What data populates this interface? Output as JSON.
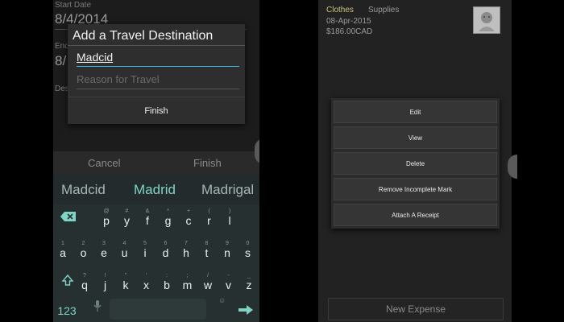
{
  "left": {
    "background": {
      "start_label": "Start Date",
      "start_value": "8/4/2014",
      "end_label_partial": "End",
      "end_value_partial": "8/",
      "desc_label_partial": "Des"
    },
    "dialog": {
      "title": "Add a Travel Destination",
      "destination_value": "Madcid",
      "reason_placeholder": "Reason for Travel",
      "finish_label": "Finish"
    },
    "bottom_buttons": {
      "cancel": "Cancel",
      "finish": "Finish"
    },
    "suggestions": [
      "Madcid",
      "Madrid",
      "Madrigal"
    ],
    "keyboard": {
      "row1": [
        {
          "ch": "p",
          "hint": "@"
        },
        {
          "ch": "y",
          "hint": "#"
        },
        {
          "ch": "f",
          "hint": "&"
        },
        {
          "ch": "g",
          "hint": "*"
        },
        {
          "ch": "c",
          "hint": "+"
        },
        {
          "ch": "r",
          "hint": "("
        },
        {
          "ch": "l",
          "hint": ")"
        }
      ],
      "row2": [
        {
          "ch": "a",
          "hint": "1"
        },
        {
          "ch": "o",
          "hint": "2"
        },
        {
          "ch": "e",
          "hint": "3"
        },
        {
          "ch": "u",
          "hint": "4"
        },
        {
          "ch": "i",
          "hint": "5"
        },
        {
          "ch": "d",
          "hint": "6"
        },
        {
          "ch": "h",
          "hint": "7"
        },
        {
          "ch": "t",
          "hint": "8"
        },
        {
          "ch": "n",
          "hint": "9"
        },
        {
          "ch": "s",
          "hint": "0"
        }
      ],
      "row3": [
        {
          "ch": "q",
          "hint": "?"
        },
        {
          "ch": "j",
          "hint": "!"
        },
        {
          "ch": "k",
          "hint": "\""
        },
        {
          "ch": "x",
          "hint": "'"
        },
        {
          "ch": "b",
          "hint": ":"
        },
        {
          "ch": "m",
          "hint": ";"
        },
        {
          "ch": "w",
          "hint": "/"
        },
        {
          "ch": "v",
          "hint": "-"
        },
        {
          "ch": "z",
          "hint": "_"
        }
      ],
      "numbers_key": "123",
      "accent_color": "#7fd4c6"
    }
  },
  "right": {
    "category_primary": "Clothes",
    "category_secondary": "Supplies",
    "date": "08-Apr-2015",
    "amount": "$186.00CAD",
    "menu_items": [
      "Edit",
      "View",
      "Delete",
      "Remove Incomplete Mark",
      "Attach A Receipt"
    ],
    "new_expense": "New Expense"
  }
}
